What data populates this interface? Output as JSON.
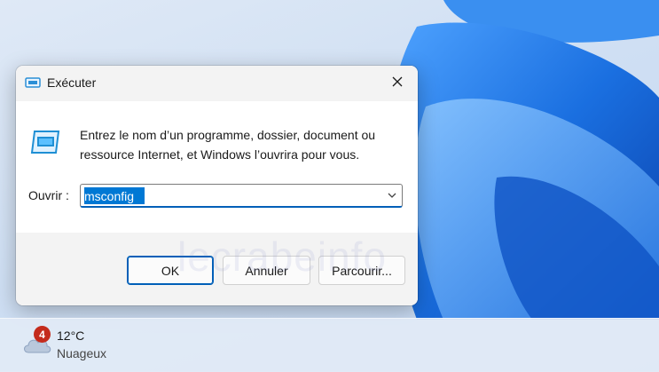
{
  "dialog": {
    "title": "Exécuter",
    "description": "Entrez le nom d’un programme, dossier, document ou ressource Internet, et Windows l’ouvrira pour vous.",
    "open_label": "Ouvrir :",
    "input_value": "msconfig",
    "buttons": {
      "ok": "OK",
      "cancel": "Annuler",
      "browse": "Parcourir..."
    },
    "icons": {
      "title": "run-icon",
      "program": "run-program-icon",
      "close": "close-icon",
      "dropdown": "chevron-down-icon"
    }
  },
  "watermark": "lecrabeinfo",
  "taskbar": {
    "weather": {
      "badge": "4",
      "temperature": "12°C",
      "condition": "Nuageux",
      "icon": "cloud-icon"
    }
  },
  "colors": {
    "accent": "#005fb8",
    "selection": "#0078d4",
    "badge": "#c42b1c",
    "wallpaper_blue": "#1a6fe0"
  }
}
